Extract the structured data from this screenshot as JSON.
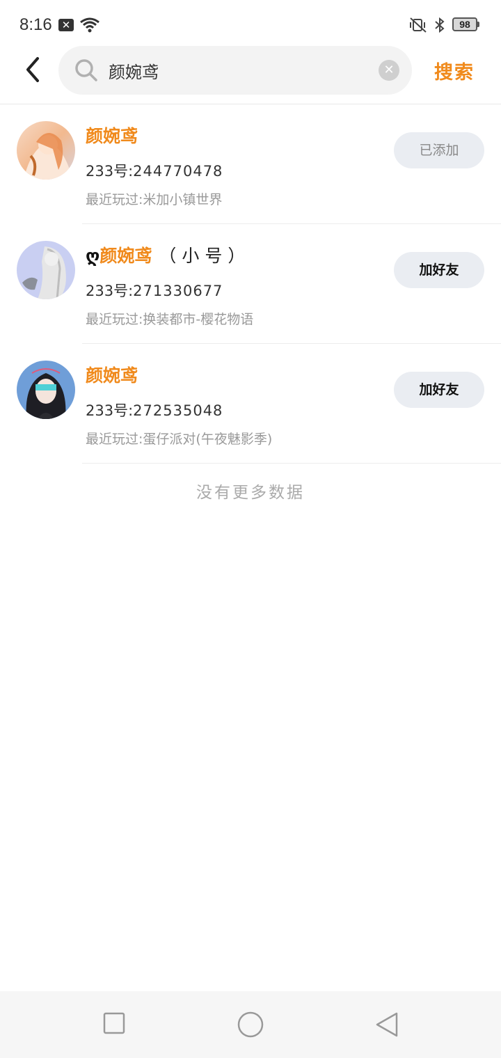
{
  "status_bar": {
    "time": "8:16",
    "notification_badge": "✕",
    "battery": "98",
    "icons": [
      "wifi-icon",
      "vibrate-mute-icon",
      "bluetooth-icon",
      "battery-icon"
    ]
  },
  "header": {
    "search_value": "颜婉鸢",
    "search_action": "搜索"
  },
  "results": [
    {
      "prefix": "",
      "name": "颜婉鸢",
      "suffix": "",
      "uid_label": "233号:",
      "uid_value": "244770478",
      "recent": "最近玩过:米加小镇世界",
      "button": "已添加",
      "button_state": "added"
    },
    {
      "prefix": "ღ",
      "name": "颜婉鸢",
      "suffix": "（小号）",
      "uid_label": "233号:",
      "uid_value": "271330677",
      "recent": "最近玩过:换装都市-樱花物语",
      "button": "加好友",
      "button_state": "add"
    },
    {
      "prefix": "",
      "name": "颜婉鸢",
      "suffix": "",
      "uid_label": "233号:",
      "uid_value": "272535048",
      "recent": "最近玩过:蛋仔派对(午夜魅影季)",
      "button": "加好友",
      "button_state": "add"
    }
  ],
  "no_more": "没有更多数据",
  "colors": {
    "accent": "#f08a1c",
    "button_bg": "#eaedf2",
    "muted_text": "#999999"
  }
}
